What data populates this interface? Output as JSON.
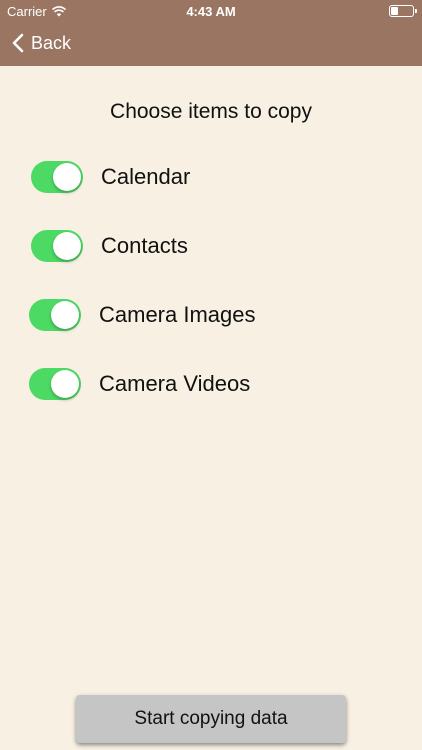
{
  "status_bar": {
    "carrier": "Carrier",
    "time": "4:43 AM"
  },
  "nav": {
    "back_label": "Back"
  },
  "heading": "Choose items to copy",
  "items": [
    {
      "label": "Calendar",
      "enabled": true
    },
    {
      "label": "Contacts",
      "enabled": true
    },
    {
      "label": "Camera Images",
      "enabled": true
    },
    {
      "label": "Camera Videos",
      "enabled": true
    }
  ],
  "start_button_label": "Start copying data",
  "colors": {
    "nav_bar": "#9a7662",
    "background": "#f7f0e3",
    "toggle_on": "#4cd964",
    "button": "#c5c5c5"
  }
}
